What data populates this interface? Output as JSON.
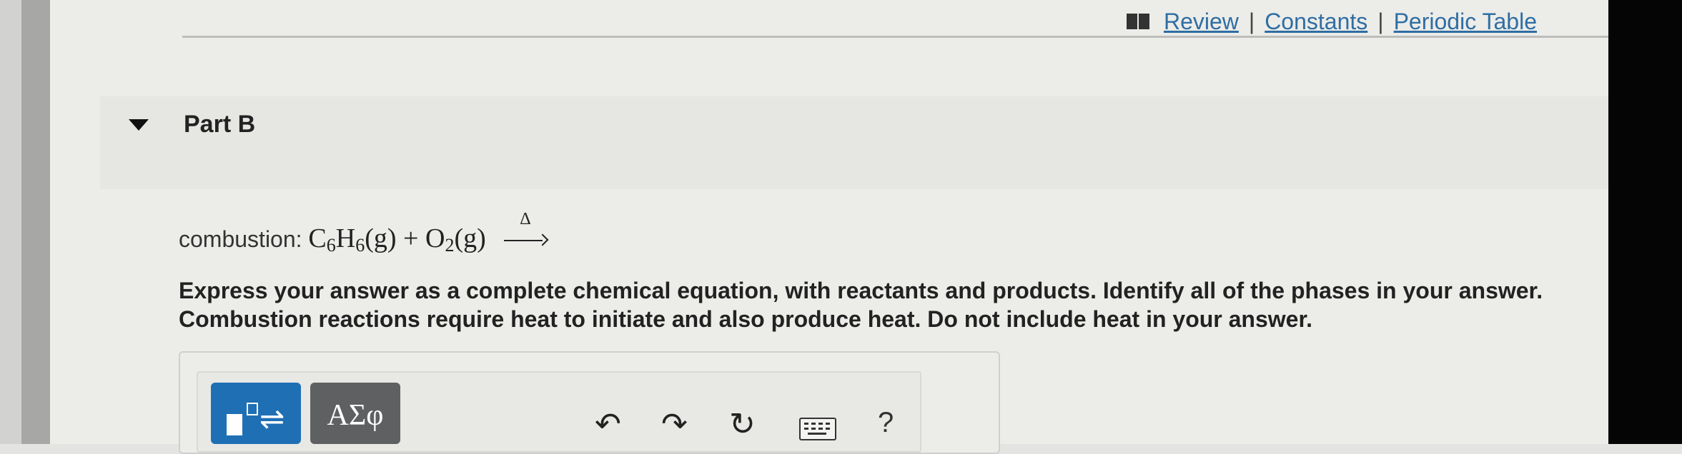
{
  "links": {
    "review": "Review",
    "constants": "Constants",
    "periodic_table": "Periodic Table",
    "separator": "|"
  },
  "part": {
    "title": "Part B"
  },
  "question": {
    "label": "combustion:",
    "reactant1_a": "C",
    "reactant1_a_sub": "6",
    "reactant1_b": "H",
    "reactant1_b_sub": "6",
    "reactant1_phase": "(g)",
    "plus": "+",
    "reactant2": "O",
    "reactant2_sub": "2",
    "reactant2_phase": "(g)",
    "arrow_label": "Δ",
    "instructions": "Express your answer as a complete chemical equation, with reactants and products. Identify all of the phases in your answer. Combustion reactions require heat to initiate and also produce heat. Do not include heat in your answer."
  },
  "toolbar": {
    "symbols_label": "ΑΣφ",
    "equilibrium_glyph": "⇌",
    "undo_glyph": "↶",
    "redo_glyph": "↷",
    "reset_glyph": "↻",
    "help_label": "?"
  },
  "colors": {
    "link": "#2f6ea3",
    "template_button": "#1f6fb5",
    "symbol_button": "#5f6062"
  }
}
